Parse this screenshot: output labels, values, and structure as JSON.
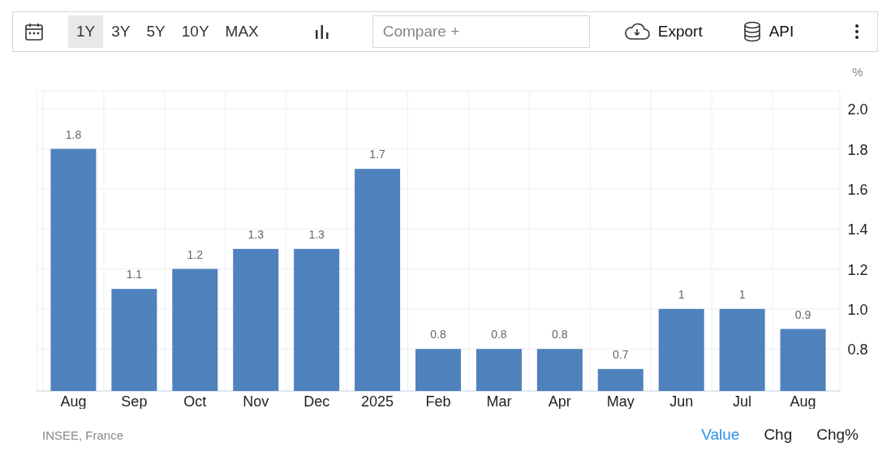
{
  "toolbar": {
    "ranges": [
      {
        "label": "1Y",
        "selected": true
      },
      {
        "label": "3Y",
        "selected": false
      },
      {
        "label": "5Y",
        "selected": false
      },
      {
        "label": "10Y",
        "selected": false
      },
      {
        "label": "MAX",
        "selected": false
      }
    ],
    "compare": {
      "placeholder": "Compare +"
    },
    "export": "Export",
    "api": "API"
  },
  "chart": {
    "chart_data": {
      "type": "bar",
      "ylabel": "%",
      "categories": [
        "Aug",
        "Sep",
        "Oct",
        "Nov",
        "Dec",
        "2025",
        "Feb",
        "Mar",
        "Apr",
        "May",
        "Jun",
        "Jul",
        "Aug"
      ],
      "grid": true,
      "series": [
        {
          "color": "#4f81bd",
          "values": [
            1.8,
            1.1,
            1.2,
            1.3,
            1.3,
            1.7,
            0.8,
            0.8,
            0.8,
            0.7,
            1,
            1,
            0.9
          ]
        }
      ],
      "value_labels": [
        "1.8",
        "1.1",
        "1.2",
        "1.3",
        "1.3",
        "1.7",
        "0.8",
        "0.8",
        "0.8",
        "0.7",
        "1",
        "1",
        "0.9"
      ],
      "ylim": [
        0.59,
        2.09
      ],
      "yticks": [
        {
          "value": 0.8,
          "label": "0.8"
        },
        {
          "value": 1.0,
          "label": "1.0"
        },
        {
          "value": 1.2,
          "label": "1.2"
        },
        {
          "value": 1.4,
          "label": "1.4"
        },
        {
          "value": 1.6,
          "label": "1.6"
        },
        {
          "value": 1.8,
          "label": "1.8"
        },
        {
          "value": 2.0,
          "label": "2.0"
        }
      ]
    }
  },
  "footer": {
    "source": "INSEE, France",
    "modes": [
      {
        "label": "Value",
        "selected": true
      },
      {
        "label": "Chg",
        "selected": false
      },
      {
        "label": "Chg%",
        "selected": false
      }
    ]
  }
}
